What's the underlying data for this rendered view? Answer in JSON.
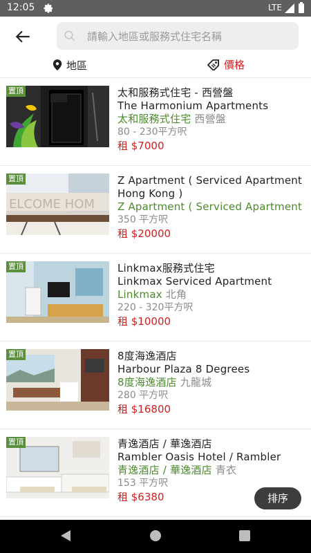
{
  "status_bar": {
    "time": "12:05",
    "network": "LTE"
  },
  "search": {
    "placeholder": "請輸入地區或服務式住宅名稱"
  },
  "filters": {
    "area_label": "地區",
    "price_label": "價格"
  },
  "listings": [
    {
      "pin": "置頂",
      "title_zh": "太和服務式住宅 - 西營盤",
      "title_en": "The Harmonium Apartments",
      "brand": "太和服務式住宅",
      "district": "西營盤",
      "size": "80 - 230平方呎",
      "price": "租 $7000"
    },
    {
      "pin": "置頂",
      "title_en": "Z Apartment ( Serviced Apartment Hong Kong )",
      "brand": " Z Apartment ( Serviced Apartment",
      "size": "350 平方呎",
      "price": "租 $20000"
    },
    {
      "pin": "置頂",
      "title_zh": "Linkmax服務式住宅",
      "title_en": "Linkmax Serviced Apartment",
      "brand": "Linkmax",
      "district": "北角",
      "size": "220 - 320平方呎",
      "price": "租 $10000"
    },
    {
      "pin": "置頂",
      "title_zh": "8度海逸酒店",
      "title_en": "Harbour Plaza 8 Degrees",
      "brand": "8度海逸酒店",
      "district": "九龍城",
      "size": "280 平方呎",
      "price": "租 $16800"
    },
    {
      "pin": "置頂",
      "title_zh": "青逸酒店 / 華逸酒店",
      "title_en": "Rambler Oasis Hotel / Rambler",
      "brand": "青逸酒店 / 華逸酒店",
      "district": "青衣",
      "size": "153 平方呎",
      "price": "租 $6380"
    }
  ],
  "sort_button": "排序",
  "colors": {
    "pin_green": "#5a8f3c",
    "brand_green": "#4a8a2a",
    "price_red": "#d12020"
  }
}
